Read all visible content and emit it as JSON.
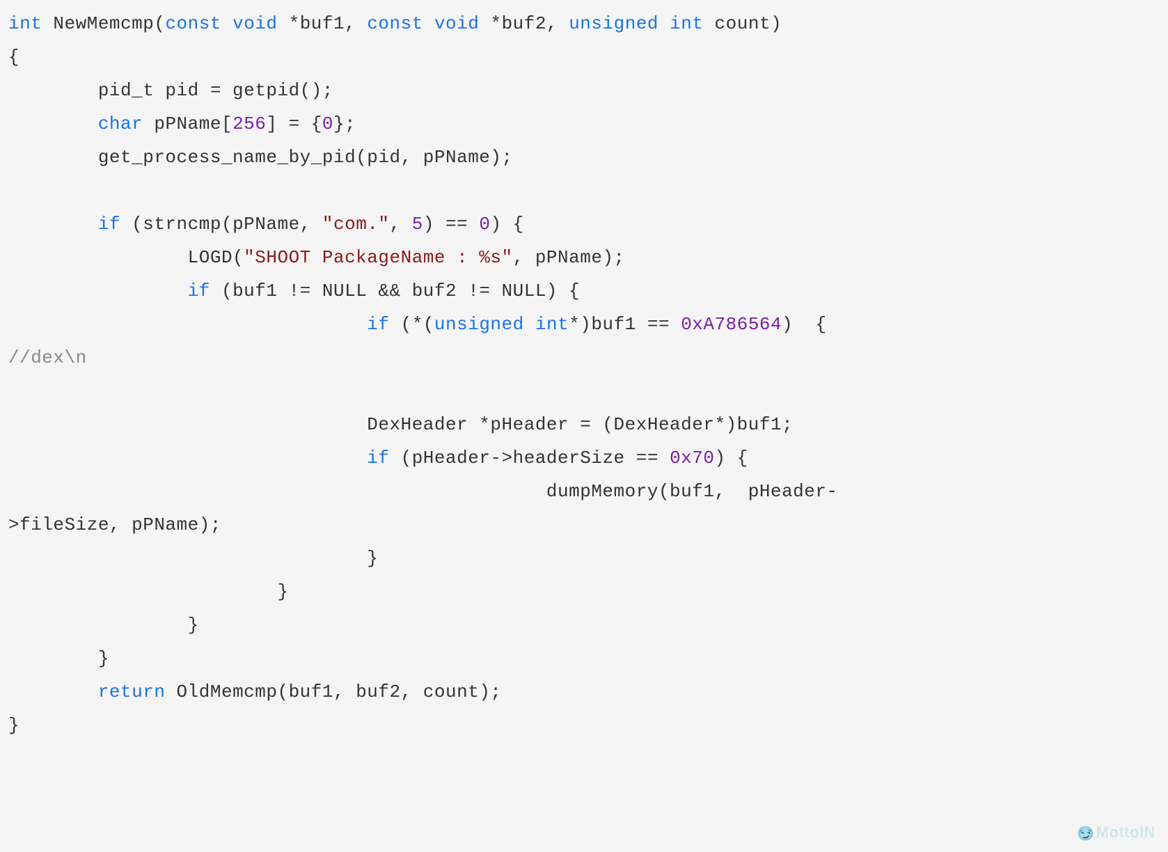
{
  "code": {
    "t_int": "int",
    "fn_name": " NewMemcmp(",
    "t_const1": "const",
    "sp_void1": " ",
    "t_void1": "void",
    "arg1": " *buf1, ",
    "t_const2": "const",
    "sp_void2": " ",
    "t_void2": "void",
    "arg2": " *buf2, ",
    "t_unsigned": "unsigned",
    "sp_uint": " ",
    "t_int2": "int",
    "arg3": " count)",
    "brace_open": "{",
    "line_pid": "        pid_t pid = getpid();",
    "line_char_pre": "        ",
    "t_char": "char",
    "line_char_mid": " pPName[",
    "n_256": "256",
    "line_char_mid2": "] = {",
    "n_0a": "0",
    "line_char_end": "};",
    "line_getproc": "        get_process_name_by_pid(pid, pPName);",
    "line_blank1": "",
    "if1_pre": "        ",
    "kw_if1": "if",
    "if1_mid": " (strncmp(pPName, ",
    "str_com": "\"com.\"",
    "if1_mid2": ", ",
    "n_5": "5",
    "if1_mid3": ") == ",
    "n_0b": "0",
    "if1_end": ") {",
    "logd_pre": "                LOGD(",
    "str_shoot": "\"SHOOT PackageName : %s\"",
    "logd_end": ", pPName);",
    "if2_pre": "                ",
    "kw_if2": "if",
    "if2_body": " (buf1 != NULL && buf2 != NULL) {",
    "if3_pre": "                                ",
    "kw_if3": "if",
    "if3_mid1": " (*(",
    "t_unsigned2": "unsigned",
    "sp_uint2": " ",
    "t_int3": "int",
    "if3_mid2": "*)buf1 == ",
    "hex_magic": "0xA786564",
    "if3_end": ")  { ",
    "comment_dex": "//dex\\n",
    "line_blank2": "",
    "line_dexh": "                                DexHeader *pHeader = (DexHeader*)buf1;",
    "if4_pre": "                                ",
    "kw_if4": "if",
    "if4_mid": " (pHeader->headerSize == ",
    "hex_70": "0x70",
    "if4_end": ") {",
    "dump_line": "                                                dumpMemory(buf1,  pHeader-",
    "dump_cont": ">fileSize, pPName);",
    "close3": "                                }",
    "close2b": "                        }",
    "close2": "                }",
    "close1": "        }",
    "ret_pre": "        ",
    "kw_return": "return",
    "ret_body": " OldMemcmp(buf1, buf2, count);",
    "brace_close": "}"
  },
  "watermark": "MottoIN"
}
